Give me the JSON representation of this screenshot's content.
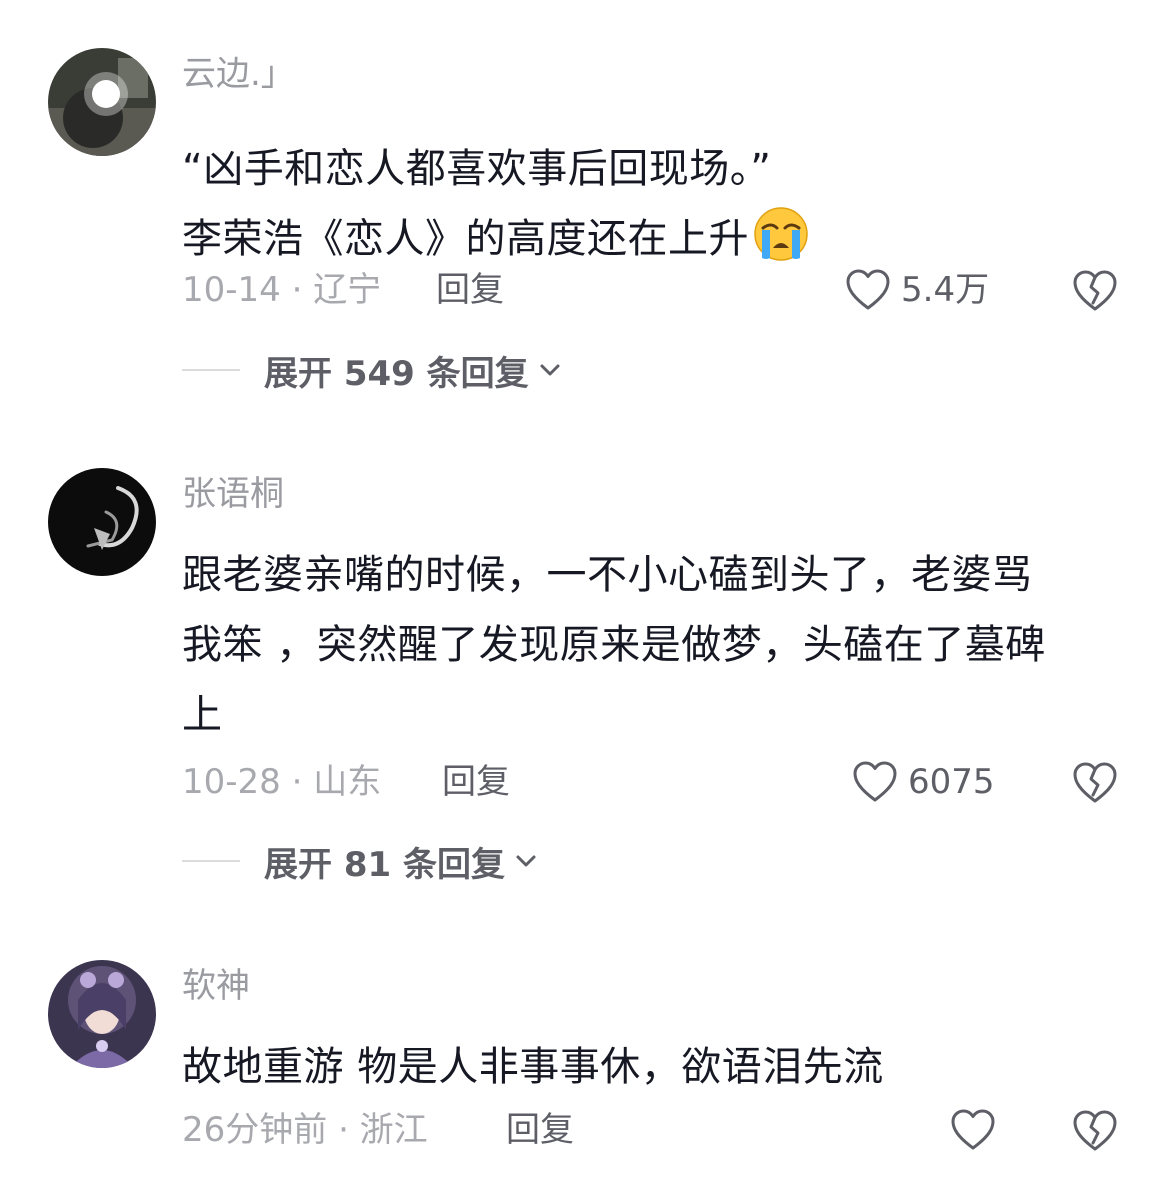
{
  "comments": [
    {
      "username": "云边.」",
      "lines": [
        "“凶手和恋人都喜欢事后回现场。”",
        "李荣浩《恋人》的高度还在上升"
      ],
      "emoji": "loudly-crying-face",
      "date_location": "10-14 · 辽宁",
      "reply_label": "回复",
      "likes": "5.4万",
      "expand_label": "展开 549 条回复"
    },
    {
      "username": "张语桐",
      "lines": [
        "跟老婆亲嘴的时候，一不小心磕到头了，老婆骂",
        "我笨 ，突然醒了发现原来是做梦，头磕在了墓碑",
        "上"
      ],
      "date_location": "10-28 · 山东",
      "reply_label": "回复",
      "likes": "6075",
      "expand_label": "展开 81 条回复"
    },
    {
      "username": "软神",
      "lines": [
        "故地重游 物是人非事事休，欲语泪先流"
      ],
      "date_location": "26分钟前 · 浙江",
      "reply_label": "回复",
      "likes": ""
    }
  ],
  "icons": {
    "like": "heart-outline-icon",
    "dislike": "broken-heart-icon",
    "expand": "chevron-down-icon"
  },
  "colors": {
    "text": "#161823",
    "secondary": "#9a9ba1",
    "action": "#5d5e66",
    "background": "#ffffff"
  }
}
